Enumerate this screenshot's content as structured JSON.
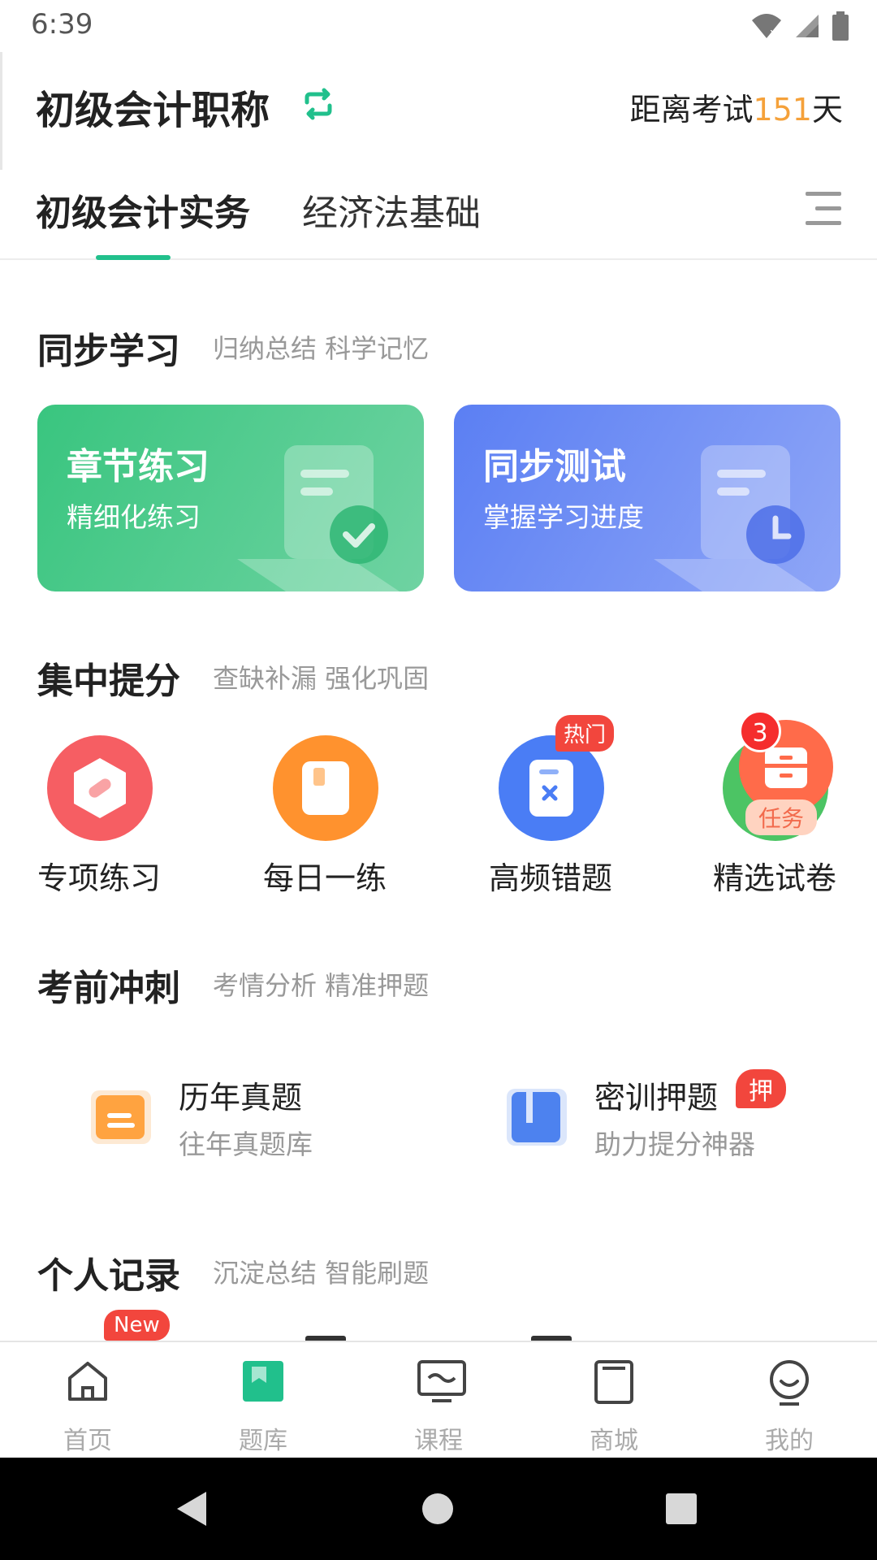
{
  "status_bar": {
    "time": "6:39"
  },
  "header": {
    "title": "初级会计职称",
    "countdown_prefix": "距离考试",
    "countdown_days": "151",
    "countdown_suffix": "天"
  },
  "tabs": [
    {
      "label": "初级会计实务",
      "active": true
    },
    {
      "label": "经济法基础",
      "active": false
    }
  ],
  "sections": {
    "sync": {
      "title": "同步学习",
      "subtitle": "归纳总结 科学记忆"
    },
    "focus": {
      "title": "集中提分",
      "subtitle": "查缺补漏 强化巩固"
    },
    "sprint": {
      "title": "考前冲刺",
      "subtitle": "考情分析 精准押题"
    },
    "records": {
      "title": "个人记录",
      "subtitle": "沉淀总结 智能刷题"
    }
  },
  "cards": [
    {
      "title": "章节练习",
      "subtitle": "精细化练习",
      "color": "#39c57f"
    },
    {
      "title": "同步测试",
      "subtitle": "掌握学习进度",
      "color": "#5b7ff3"
    }
  ],
  "grid": [
    {
      "label": "专项练习",
      "icon": "bandage-icon",
      "color": "#f45b5b"
    },
    {
      "label": "每日一练",
      "icon": "book-icon",
      "color": "#ff8f2e"
    },
    {
      "label": "高频错题",
      "icon": "wrong-paper-icon",
      "color": "#4a7df5",
      "badge": "热门"
    },
    {
      "label": "精选试卷",
      "icon": "cabinet-icon",
      "color": "#ff6b4a",
      "badge_count": "3",
      "task_badge": "任务"
    }
  ],
  "entries": [
    {
      "title": "历年真题",
      "subtitle": "往年真题库",
      "icon": "folder-icon"
    },
    {
      "title": "密训押题",
      "subtitle": "助力提分神器",
      "icon": "notebook-icon",
      "badge": "押"
    }
  ],
  "records_badge": "New",
  "bottom_nav": [
    {
      "label": "首页",
      "icon": "home-icon"
    },
    {
      "label": "题库",
      "icon": "question-bank-icon",
      "active": true
    },
    {
      "label": "课程",
      "icon": "monitor-icon"
    },
    {
      "label": "商城",
      "icon": "shop-icon"
    },
    {
      "label": "我的",
      "icon": "profile-icon"
    }
  ],
  "colors": {
    "accent": "#21c08c",
    "orange": "#f5a13a",
    "badge_red": "#f2463d"
  }
}
